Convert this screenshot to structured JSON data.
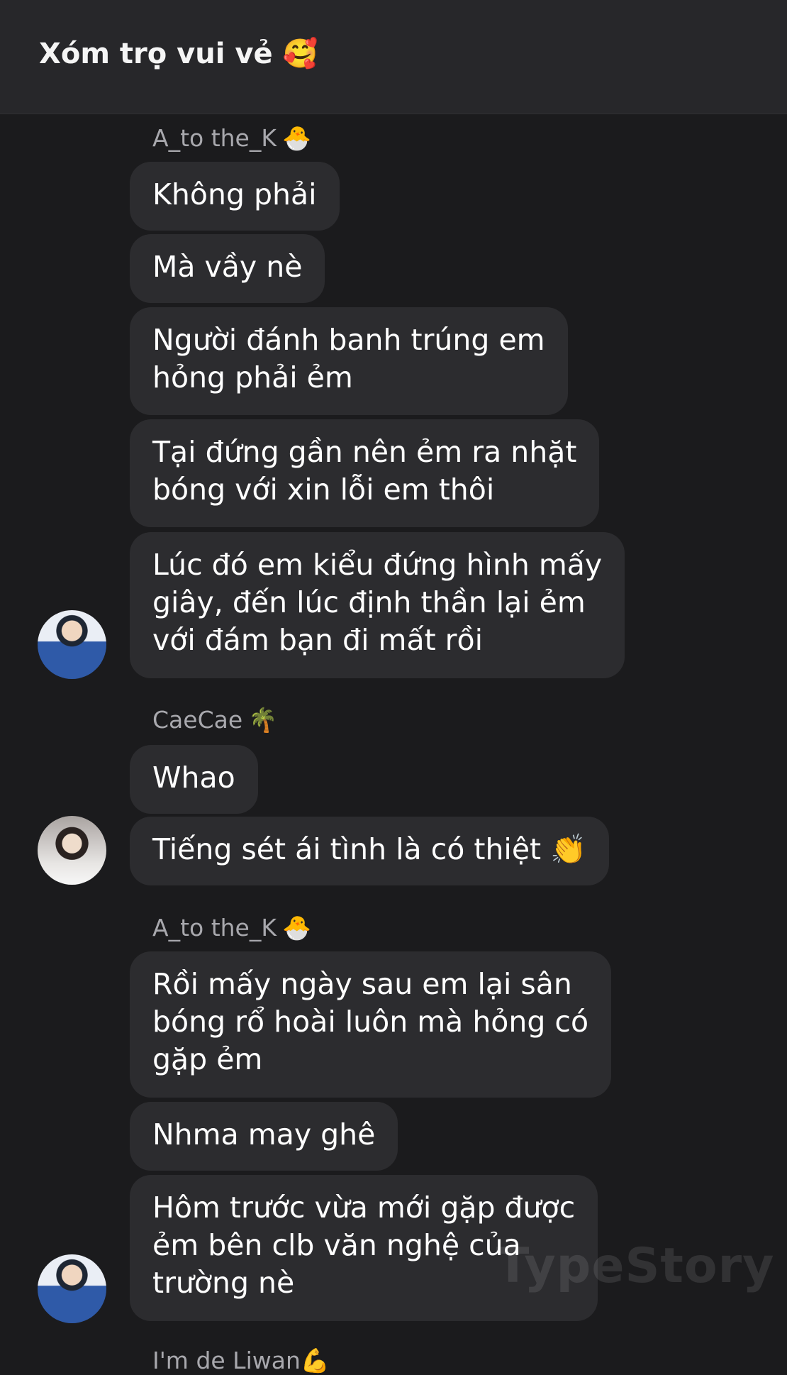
{
  "header": {
    "title": "Xóm trọ vui vẻ",
    "title_emoji": "🥰"
  },
  "messages": {
    "g1": {
      "sender": "A_to the_K",
      "sender_emoji": "🐣",
      "m1": "Không phải",
      "m2": "Mà vầy nè",
      "m3_l1": "Người đánh banh trúng em",
      "m3_l2": "hỏng phải ẻm",
      "m4_l1": "Tại đứng gần nên ẻm ra nhặt",
      "m4_l2": "bóng với xin lỗi em thôi",
      "m5_l1": "Lúc đó em kiểu đứng hình mấy",
      "m5_l2": "giây, đến lúc định thần lại ẻm",
      "m5_l3": "với đám bạn đi mất rồi"
    },
    "g2": {
      "sender": "CaeCae",
      "sender_emoji": "🌴",
      "m1": "Whao",
      "m2": "Tiếng sét ái tình là có thiệt",
      "m2_emoji": "👏"
    },
    "g3": {
      "sender": "A_to the_K",
      "sender_emoji": "🐣",
      "m1_l1": "Rồi mấy ngày sau em lại sân",
      "m1_l2": "bóng rổ hoài luôn mà hỏng có",
      "m1_l3": "gặp ẻm",
      "m2": "Nhma may ghê",
      "m3_l1": "Hôm trước vừa mới gặp được",
      "m3_l2": "ẻm bên clb văn nghệ của",
      "m3_l3": "trường nè"
    },
    "next_sender_partial": "I'm de Liwan",
    "next_sender_emoji": "💪"
  },
  "watermark": "TypeStory",
  "colors": {
    "background": "#1b1b1d",
    "header": "#27272a",
    "bubble": "#2c2c2f",
    "sender": "#a8a8ad"
  }
}
